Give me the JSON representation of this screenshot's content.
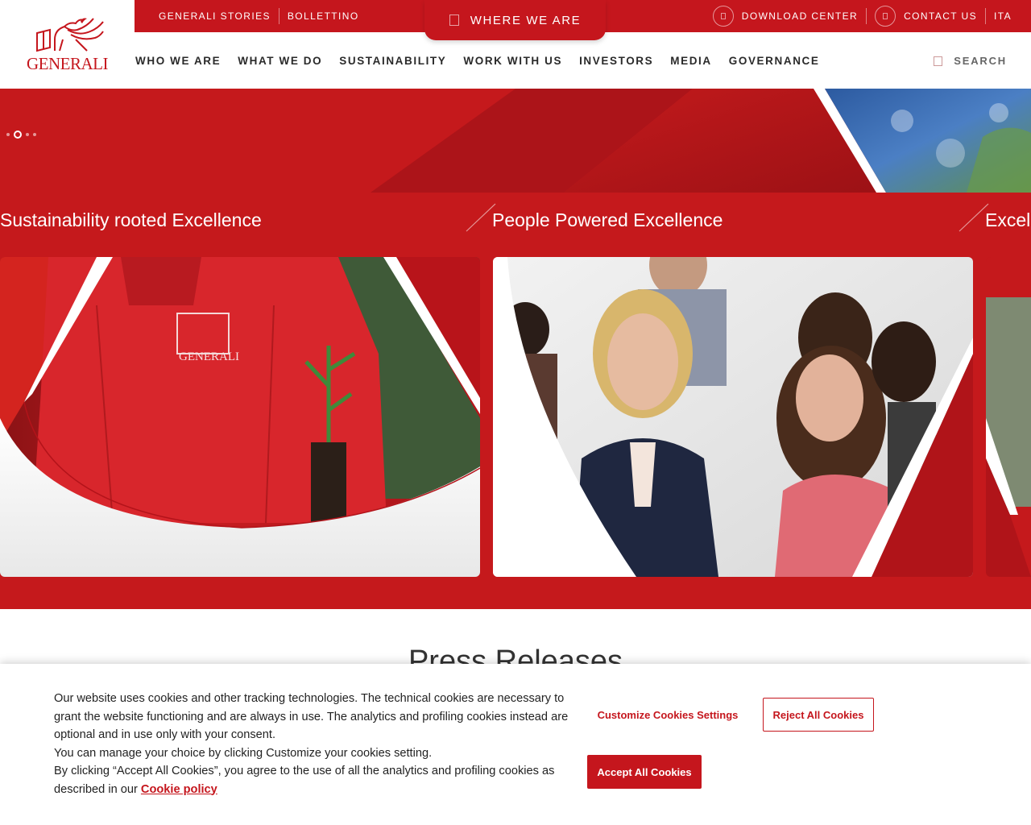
{
  "brand": {
    "logo_text": "GENERALI",
    "primary_color": "#c5161d"
  },
  "topbar": {
    "links": [
      "GENERALI STORIES",
      "BOLLETTINO"
    ],
    "where_we_are": "WHERE WE ARE",
    "download_center": "DOWNLOAD CENTER",
    "contact_us": "CONTACT US",
    "language": "ITA"
  },
  "nav": {
    "items": [
      "WHO WE ARE",
      "WHAT WE DO",
      "SUSTAINABILITY",
      "WORK WITH US",
      "INVESTORS",
      "MEDIA",
      "GOVERNANCE"
    ],
    "search_label": "SEARCH"
  },
  "carousel": {
    "cards": [
      {
        "title": "Sustainability rooted Excellence"
      },
      {
        "title": "People Powered Excellence"
      },
      {
        "title": "Excel"
      }
    ]
  },
  "press": {
    "title": "Press Releases"
  },
  "cookie_banner": {
    "line1": "Our website uses cookies and other tracking technologies. The technical cookies are necessary to grant the website functioning and are always in use. The analytics and profiling cookies instead are optional and in use only with your consent.",
    "line2": "You can manage your choice by clicking Customize your cookies setting.",
    "line3": "By clicking “Accept All Cookies”, you agree to the use of all the analytics and profiling cookies as described in our",
    "policy_link": "Cookie policy",
    "customize_label": "Customize Cookies Settings",
    "reject_label": "Reject All Cookies",
    "accept_label": "Accept All Cookies"
  }
}
